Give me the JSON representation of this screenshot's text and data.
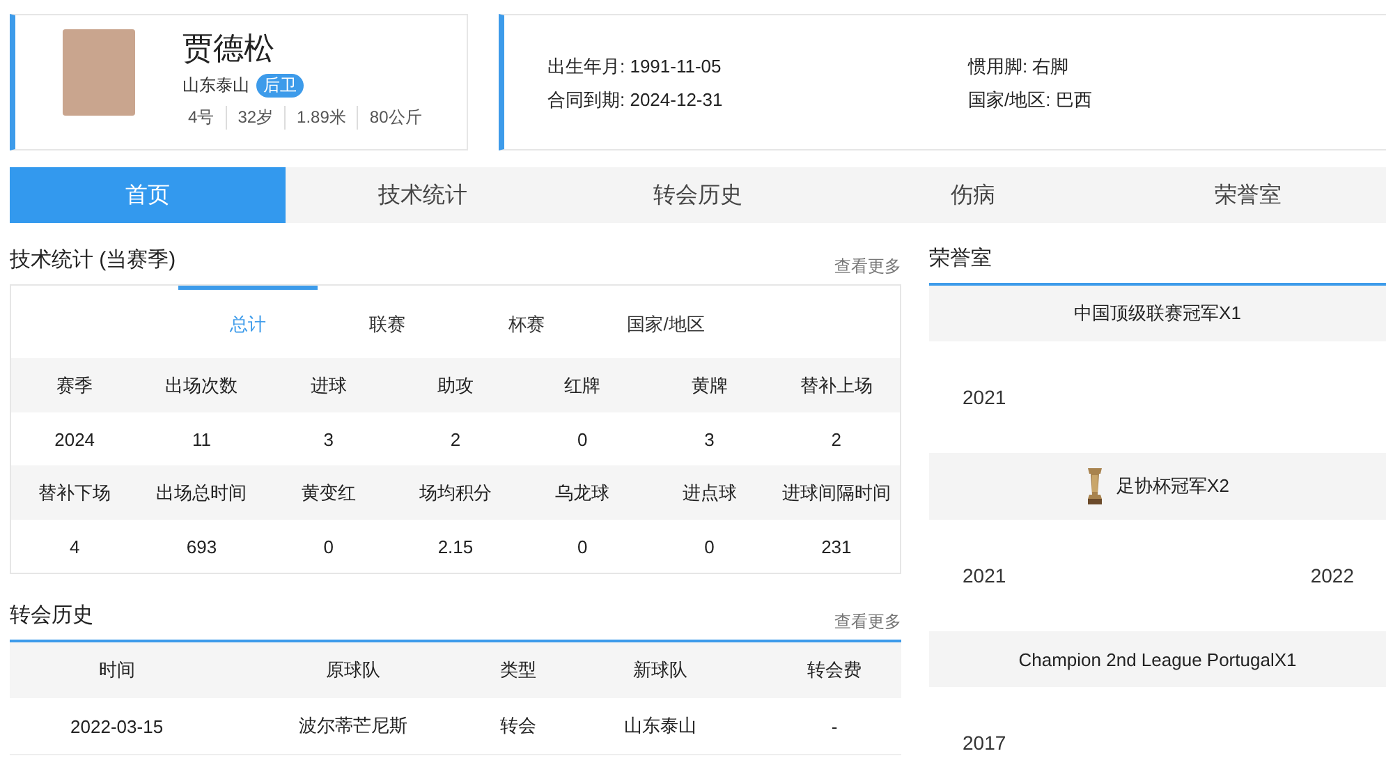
{
  "player": {
    "name": "贾德松",
    "team": "山东泰山",
    "position": "后卫",
    "facts": [
      "4号",
      "32岁",
      "1.89米",
      "80公斤"
    ]
  },
  "info": [
    "出生年月: 1991-11-05",
    "惯用脚: 右脚",
    "合同到期: 2024-12-31",
    "国家/地区: 巴西"
  ],
  "tabs": [
    {
      "label": "首页",
      "selected": true
    },
    {
      "label": "技术统计",
      "selected": false
    },
    {
      "label": "转会历史",
      "selected": false
    },
    {
      "label": "伤病",
      "selected": false
    },
    {
      "label": "荣誉室",
      "selected": false
    }
  ],
  "stats": {
    "title": "技术统计 (当赛季)",
    "more_link": "查看更多",
    "filters": [
      {
        "label": "总计",
        "selected": true
      },
      {
        "label": "联赛",
        "selected": false
      },
      {
        "label": "杯赛",
        "selected": false
      },
      {
        "label": "国家/地区",
        "selected": false
      }
    ],
    "rows": [
      {
        "kind": "header",
        "cells": [
          "赛季",
          "出场次数",
          "进球",
          "助攻",
          "红牌",
          "黄牌",
          "替补上场"
        ]
      },
      {
        "kind": "values",
        "cells": [
          "2024",
          "11",
          "3",
          "2",
          "0",
          "3",
          "2"
        ]
      },
      {
        "kind": "header",
        "cells": [
          "替补下场",
          "出场总时间",
          "黄变红",
          "场均积分",
          "乌龙球",
          "进点球",
          "进球间隔时间"
        ]
      },
      {
        "kind": "values",
        "cells": [
          "4",
          "693",
          "0",
          "2.15",
          "0",
          "0",
          "231"
        ]
      }
    ]
  },
  "transfers": {
    "title": "转会历史",
    "more_link": "查看更多",
    "columns": [
      "时间",
      "原球队",
      "类型",
      "新球队",
      "转会费"
    ],
    "rows": [
      [
        "2022-03-15",
        "波尔蒂芒尼斯",
        "转会",
        "山东泰山",
        "-"
      ]
    ]
  },
  "honors": {
    "title": "荣誉室",
    "items": [
      {
        "title": "中国顶级联赛冠军X1",
        "trophy": false,
        "years": [
          "2021"
        ]
      },
      {
        "title": "足协杯冠军X2",
        "trophy": true,
        "years": [
          "2021",
          "2022"
        ]
      },
      {
        "title": "Champion 2nd League PortugalX1",
        "trophy": false,
        "years": [
          "2017"
        ]
      }
    ]
  }
}
